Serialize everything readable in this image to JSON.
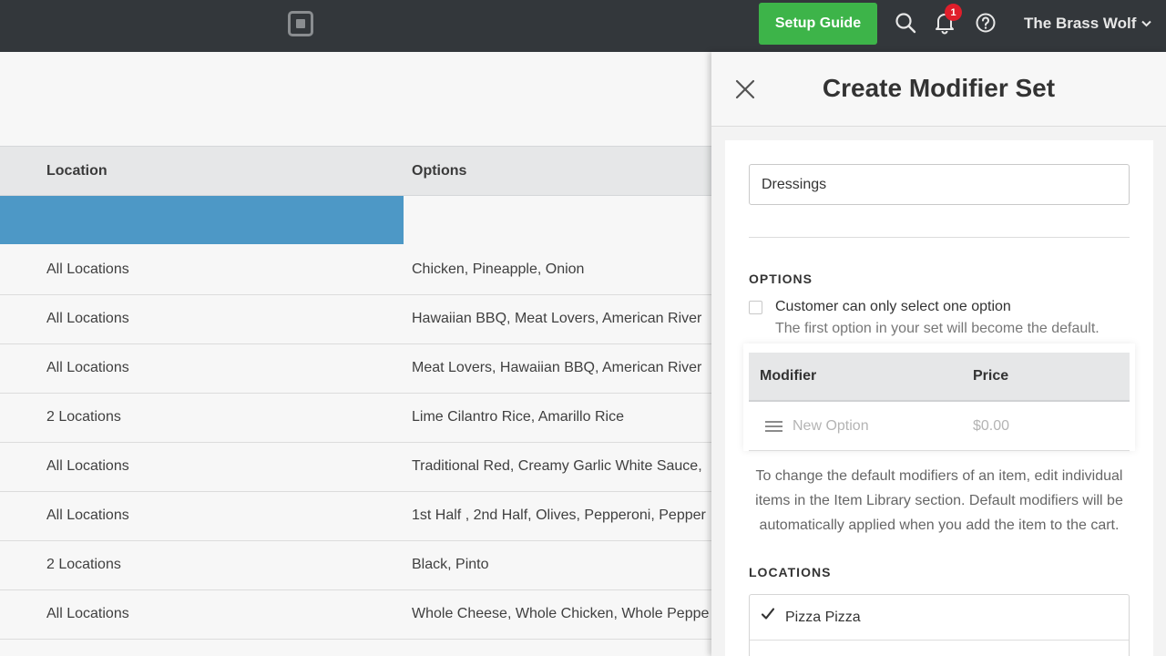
{
  "topbar": {
    "logo_icon": "square-logo-icon",
    "setup_label": "Setup Guide",
    "notification_count": "1",
    "account_name": "The Brass Wolf",
    "icons": [
      "search-icon",
      "bell-icon",
      "help-icon",
      "chevron-down-icon"
    ]
  },
  "table": {
    "headers": {
      "location": "Location",
      "options": "Options"
    },
    "rows": [
      {
        "location": "All Locations",
        "options": "Chicken, Pineapple, Onion"
      },
      {
        "location": "All Locations",
        "options": "Hawaiian BBQ, Meat Lovers, American River"
      },
      {
        "location": "All Locations",
        "options": "Meat Lovers, Hawaiian BBQ, American River"
      },
      {
        "location": "2 Locations",
        "options": "Lime Cilantro Rice, Amarillo Rice"
      },
      {
        "location": "All Locations",
        "options": "Traditional Red, Creamy Garlic White Sauce,"
      },
      {
        "location": "All Locations",
        "options": "1st Half , 2nd Half, Olives, Pepperoni, Pepper"
      },
      {
        "location": "2 Locations",
        "options": "Black, Pinto"
      },
      {
        "location": "All Locations",
        "options": "Whole Cheese, Whole Chicken, Whole Peppe"
      }
    ]
  },
  "panel": {
    "title": "Create Modifier Set",
    "name_value": "Dressings",
    "options_label": "OPTIONS",
    "single_select_label": "Customer can only select one option",
    "single_select_help": "The first option in your set will become the default.",
    "modifier_header": "Modifier",
    "price_header": "Price",
    "new_option_placeholder": "New Option",
    "price_placeholder": "$0.00",
    "note": "To change the default modifiers of an item, edit individual items in the Item Library section. Default modifiers will be automatically applied when you add the item to the cart.",
    "locations_label": "LOCATIONS",
    "locations": [
      {
        "label": "Pizza Pizza",
        "checked": true
      }
    ]
  },
  "colors": {
    "topbar": "#33373b",
    "setup_green": "#3db449",
    "selected_row_blue": "#4d98c6",
    "badge_red": "#e01e2b"
  }
}
